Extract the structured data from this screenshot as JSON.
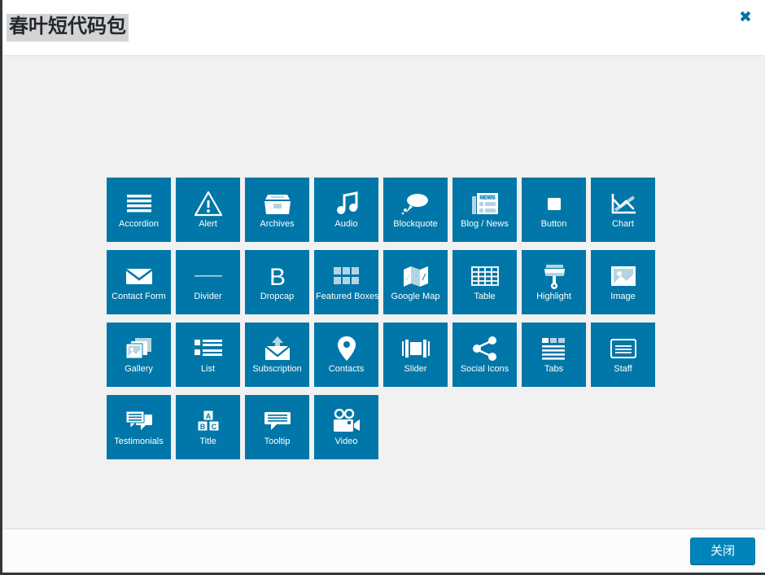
{
  "window": {
    "title": "春叶短代码包",
    "close_icon_label": "✖",
    "accent_color": "#0073aa",
    "tile_color": "#0077a8",
    "body_bg": "#f1f1f1",
    "title_highlight": "#d4d4d4"
  },
  "footer": {
    "close_button_label": "关闭"
  },
  "shortcodes": [
    {
      "label": "Accordion",
      "icon": "accordion-icon"
    },
    {
      "label": "Alert",
      "icon": "alert-icon"
    },
    {
      "label": "Archives",
      "icon": "archives-icon"
    },
    {
      "label": "Audio",
      "icon": "audio-icon"
    },
    {
      "label": "Blockquote",
      "icon": "blockquote-icon"
    },
    {
      "label": "Blog / News",
      "icon": "blog-news-icon"
    },
    {
      "label": "Button",
      "icon": "button-icon"
    },
    {
      "label": "Chart",
      "icon": "chart-icon"
    },
    {
      "label": "Contact Form",
      "icon": "contact-form-icon"
    },
    {
      "label": "Divider",
      "icon": "divider-icon"
    },
    {
      "label": "Dropcap",
      "icon": "dropcap-icon"
    },
    {
      "label": "Featured Boxes",
      "icon": "featured-boxes-icon"
    },
    {
      "label": "Google Map",
      "icon": "google-map-icon"
    },
    {
      "label": "Table",
      "icon": "table-icon"
    },
    {
      "label": "Highlight",
      "icon": "highlight-icon"
    },
    {
      "label": "Image",
      "icon": "image-icon"
    },
    {
      "label": "Gallery",
      "icon": "gallery-icon"
    },
    {
      "label": "List",
      "icon": "list-icon"
    },
    {
      "label": "Subscription",
      "icon": "subscription-icon"
    },
    {
      "label": "Contacts",
      "icon": "contacts-icon"
    },
    {
      "label": "Slider",
      "icon": "slider-icon"
    },
    {
      "label": "Social Icons",
      "icon": "social-icons-icon"
    },
    {
      "label": "Tabs",
      "icon": "tabs-icon"
    },
    {
      "label": "Staff",
      "icon": "staff-icon"
    },
    {
      "label": "Testimonials",
      "icon": "testimonials-icon"
    },
    {
      "label": "Title",
      "icon": "title-icon"
    },
    {
      "label": "Tooltip",
      "icon": "tooltip-icon"
    },
    {
      "label": "Video",
      "icon": "video-icon"
    }
  ],
  "icon_glyphs": {
    "dropcap_letter": "B",
    "blog_news_header": "NEWS",
    "title_blocks": [
      "A",
      "B",
      "C"
    ]
  }
}
